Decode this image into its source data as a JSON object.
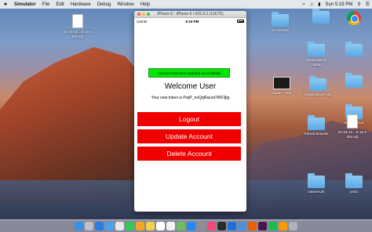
{
  "menubar": {
    "apple": "",
    "app_name": "Simulator",
    "items": [
      "File",
      "Edit",
      "Hardware",
      "Debug",
      "Window",
      "Help"
    ],
    "day_time": "Sun 5:19 PM"
  },
  "desktop_icons": [
    {
      "label": "01-03-16 ...5-16-2",
      "sub": "title.sql",
      "kind": "doc"
    },
    {
      "label": "",
      "sub": "",
      "kind": "chrome"
    },
    {
      "label": "moviefinder",
      "sub": "",
      "kind": "folder"
    },
    {
      "label": "",
      "sub": "",
      "kind": "folder"
    },
    {
      "label": "",
      "sub": "",
      "kind": "folder"
    },
    {
      "label": "ReactNative",
      "sub": "master",
      "kind": "folder"
    },
    {
      "label": "",
      "sub": "",
      "kind": "folder"
    },
    {
      "label": "Sarah - Test",
      "sub": "",
      "kind": "thumb"
    },
    {
      "label": "ReactNativePass",
      "sub": "",
      "kind": "folder"
    },
    {
      "label": "ReactNative",
      "sub": "",
      "kind": "folder"
    },
    {
      "label": "GitHub Browser",
      "sub": "",
      "kind": "folder"
    },
    {
      "label": "01-03-16 ...6-15-2",
      "sub": "title.sql",
      "kind": "doc"
    },
    {
      "label": "nativeAuth",
      "sub": "",
      "kind": "folder"
    },
    {
      "label": "part1",
      "sub": "",
      "kind": "folder"
    }
  ],
  "simulator": {
    "window_title": "iPhone 6 - iPhone 6 / iOS 9.2 (13C75)",
    "carrier": "Carrier",
    "time": "5:19 PM",
    "toast": "Account has been updated successfully",
    "welcome": "Welcome User",
    "token_text": "Your new token is PwjP_noQqRacxd7WF3jlg",
    "buttons": {
      "logout": "Logout",
      "update": "Update Account",
      "delete": "Delete Account"
    },
    "colors": {
      "button_red": "#f00000",
      "toast_green": "#00e600"
    }
  },
  "dock": {
    "apps": [
      "finder",
      "launchpad",
      "safari",
      "mail",
      "chrome",
      "messages",
      "photos",
      "notes",
      "calendar",
      "reminders",
      "maps",
      "app-store",
      "system-prefs",
      "itunes",
      "terminal",
      "xcode",
      "simulator",
      "firefox",
      "slack",
      "spotify",
      "sublime",
      "trash"
    ]
  }
}
